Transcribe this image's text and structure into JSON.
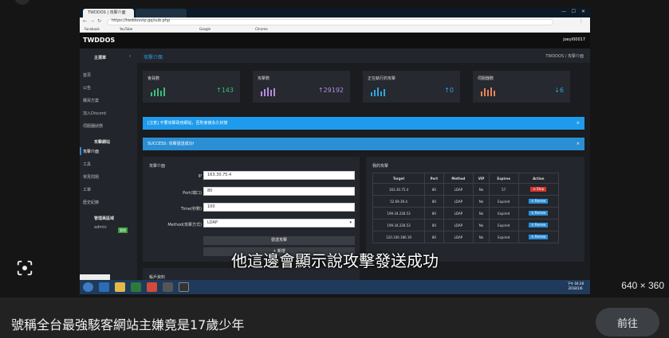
{
  "viewer": {
    "dims": "640 × 360",
    "caption": "號稱全台最強駭客網站主嫌竟是17歲少年",
    "visit_label": "前往"
  },
  "browser": {
    "tab_active": "TWDDOS | 攻擊介面",
    "tab_inactive": "",
    "url": "https://twddosvip.gq/sub.php",
    "bookmarks": [
      "Facebook",
      "YouTube",
      "Google",
      "Chrome"
    ]
  },
  "app": {
    "logo": "TWDDOS",
    "user": "joeyl00017",
    "page_title": "攻擊介面",
    "breadcrumb": "TWDDOS / 攻擊介面"
  },
  "sidebar": {
    "head_main": "主選單",
    "items": [
      "首頁",
      "公告",
      "購買方案",
      "加入Discord",
      "伺服器狀態"
    ],
    "head_attack": "攻擊網站",
    "attack_items": [
      "攻擊介面",
      "工具",
      "常見問題",
      "工單",
      "歷史紀錄"
    ],
    "head_admin": "管理員區域",
    "admin_item": "admin",
    "admin_badge": "管理"
  },
  "stats": [
    {
      "label": "會員數",
      "value": "143",
      "color": "#3bbf7a"
    },
    {
      "label": "攻擊數",
      "value": "29192",
      "color": "#b58de0"
    },
    {
      "label": "正在執行的攻擊",
      "value": "0",
      "color": "#2fa6e0"
    },
    {
      "label": "伺服器數",
      "value": "6",
      "color": "#e8835a"
    }
  ],
  "alerts": {
    "info": "[注意] 不要攻擊政府網站，否則會被永久封禁",
    "success": "SUCCESS: 攻擊發送成功!"
  },
  "form": {
    "title": "攻擊介面",
    "ip_label": "IP",
    "ip_value": "163.30.75.4",
    "port_label": "Port(端口)",
    "port_value": "80",
    "time_label": "Time(秒數)",
    "time_value": "100",
    "method_label": "Method(攻擊方式)",
    "method_value": "LDAP",
    "send_label": "發送攻擊",
    "add_label": "+ 新增"
  },
  "running": {
    "title": "我的攻擊",
    "columns": [
      "Target",
      "Port",
      "Method",
      "VIP",
      "Expires",
      "Action"
    ],
    "rows": [
      [
        "163.30.75.4",
        "80",
        "LDAP",
        "No",
        "57",
        "Stop"
      ],
      [
        "52.69.39.4",
        "80",
        "LDAP",
        "No",
        "Expired",
        "Renew"
      ],
      [
        "199.34.228.53",
        "80",
        "LDAP",
        "No",
        "Expired",
        "Renew"
      ],
      [
        "199.34.228.53",
        "80",
        "LDAP",
        "No",
        "Expired",
        "Renew"
      ],
      [
        "120.100.180.19",
        "80",
        "LDAP",
        "No",
        "Expired",
        "Renew"
      ]
    ]
  },
  "bottom_panel": "帳戶資料",
  "subtitle": "他這邊會顯示說攻擊發送成功",
  "taskbar": {
    "time": "下午 04:28",
    "date": "2018/1/6"
  }
}
